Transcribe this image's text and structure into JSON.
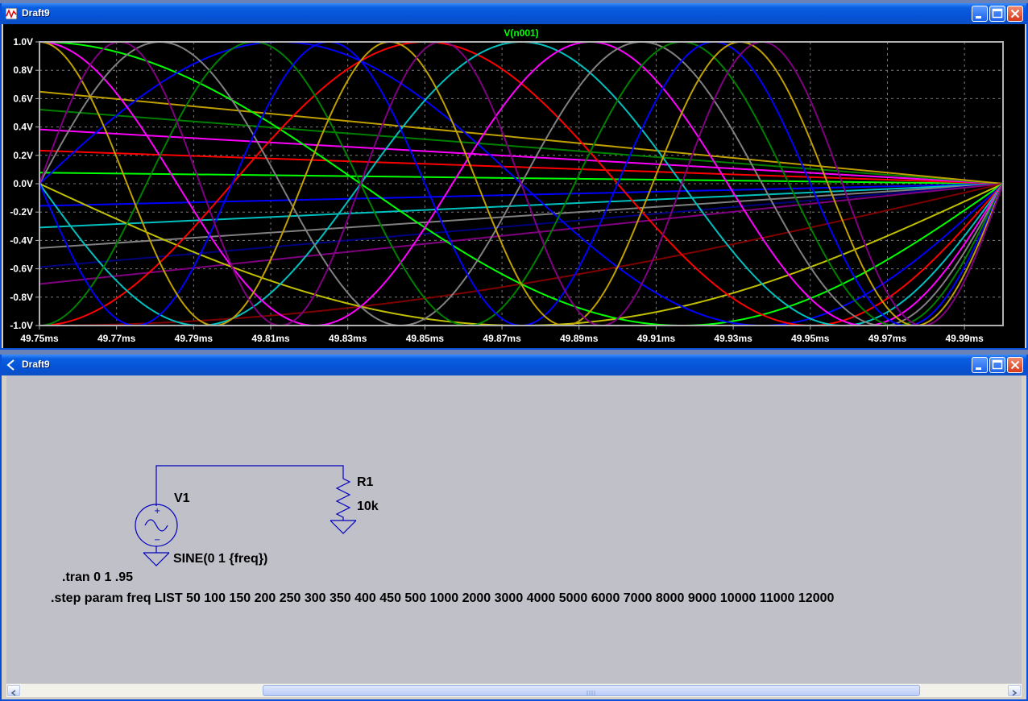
{
  "plot_window": {
    "title": "Draft9",
    "trace_label": "V(n001)"
  },
  "schematic_window": {
    "title": "Draft9",
    "components": {
      "v1_name": "V1",
      "v1_value": "SINE(0 1 {freq})",
      "r1_name": "R1",
      "r1_value": "10k"
    },
    "directives": {
      "tran": ".tran 0 1 .95",
      "step": ".step param freq LIST 50 100 150 200 250 300 350 400 450 500 1000 2000 3000 4000 5000 6000 7000 8000 9000 10000 11000 12000"
    }
  },
  "colors": {
    "titlebar": "#0a5fe0",
    "plot_bg": "#000000",
    "grid": "#808080",
    "trace_label": "#00ff00",
    "wire": "#0000c0",
    "schematic_bg": "#c0c0c8"
  },
  "chart_data": {
    "type": "line",
    "title": "V(n001)",
    "x_tick_labels": [
      "49.75ms",
      "49.77ms",
      "49.79ms",
      "49.81ms",
      "49.83ms",
      "49.85ms",
      "49.87ms",
      "49.89ms",
      "49.91ms",
      "49.93ms",
      "49.95ms",
      "49.97ms",
      "49.99ms"
    ],
    "y_tick_labels": [
      "1.0V",
      "0.8V",
      "0.6V",
      "0.4V",
      "0.2V",
      "0.0V",
      "-0.2V",
      "-0.4V",
      "-0.6V",
      "-0.8V",
      "-1.0V"
    ],
    "xlim_ms": [
      49.75,
      50.0
    ],
    "ylim": [
      -1.0,
      1.0
    ],
    "grid": true,
    "x_start_ms": 49.75,
    "x_end_ms": 50.0,
    "series": [
      {
        "freq": 50,
        "color": "#00ff00"
      },
      {
        "freq": 100,
        "color": "#0000ff"
      },
      {
        "freq": 150,
        "color": "#ff0000"
      },
      {
        "freq": 200,
        "color": "#00c0c0"
      },
      {
        "freq": 250,
        "color": "#ff00ff"
      },
      {
        "freq": 300,
        "color": "#808080"
      },
      {
        "freq": 350,
        "color": "#008000"
      },
      {
        "freq": 400,
        "color": "#000080"
      },
      {
        "freq": 450,
        "color": "#c0a000"
      },
      {
        "freq": 500,
        "color": "#800080"
      },
      {
        "freq": 1000,
        "color": "#800000"
      },
      {
        "freq": 2000,
        "color": "#c0c000"
      },
      {
        "freq": 3000,
        "color": "#00ff00"
      },
      {
        "freq": 4000,
        "color": "#0000ff"
      },
      {
        "freq": 5000,
        "color": "#ff0000"
      },
      {
        "freq": 6000,
        "color": "#00c0c0"
      },
      {
        "freq": 7000,
        "color": "#ff00ff"
      },
      {
        "freq": 8000,
        "color": "#808080"
      },
      {
        "freq": 9000,
        "color": "#008000"
      },
      {
        "freq": 10000,
        "color": "#0000ff"
      },
      {
        "freq": 11000,
        "color": "#c0a000"
      },
      {
        "freq": 12000,
        "color": "#800080"
      }
    ]
  }
}
